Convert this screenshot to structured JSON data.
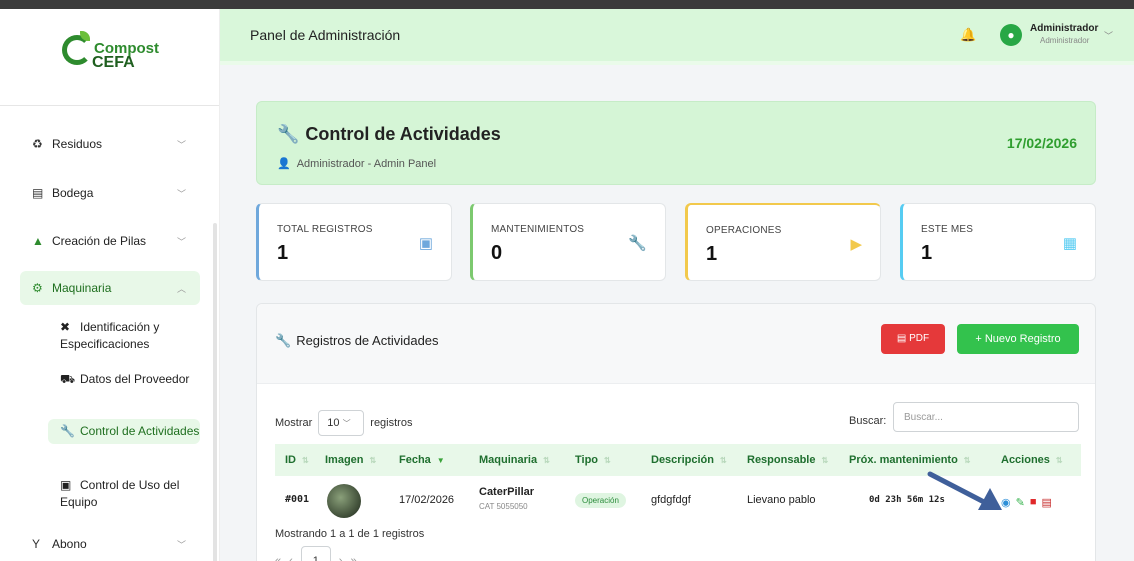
{
  "app": {
    "logo_line1": "Compost",
    "logo_line2": "CEFA",
    "accent": "#33c24d"
  },
  "sidebar": {
    "items": [
      {
        "label": "Residuos",
        "icon": "recycle-icon"
      },
      {
        "label": "Bodega",
        "icon": "warehouse-icon"
      },
      {
        "label": "Creación de Pilas",
        "icon": "mountain-icon"
      },
      {
        "label": "Maquinaria",
        "icon": "gears-icon"
      },
      {
        "label": "Abono",
        "icon": "seedling-icon"
      }
    ],
    "subitems": [
      {
        "label": "Identificación y Especificaciones",
        "icon": "tools-icon"
      },
      {
        "label": "Datos del Proveedor",
        "icon": "truck-icon"
      },
      {
        "label": "Control de Actividades",
        "icon": "wrench-icon"
      },
      {
        "label": "Control de Uso del Equipo",
        "icon": "clipboard-icon"
      }
    ]
  },
  "header": {
    "title": "Panel de Administración",
    "user_name": "Administrador",
    "user_role": "Administrador"
  },
  "hero": {
    "title": "Control de Actividades",
    "subtitle": "Administrador - Admin Panel",
    "date": "17/02/2026"
  },
  "stats": [
    {
      "label": "TOTAL REGISTROS",
      "value": "1",
      "color": "#6fa8dc"
    },
    {
      "label": "MANTENIMIENTOS",
      "value": "0",
      "color": "#7cc96f"
    },
    {
      "label": "OPERACIONES",
      "value": "1",
      "color": "#f2c94c"
    },
    {
      "label": "ESTE MES",
      "value": "1",
      "color": "#56ccf2"
    }
  ],
  "panel": {
    "title": "Registros de Actividades",
    "pdf_label": "PDF",
    "new_label": "+ Nuevo Registro",
    "show_label": "Mostrar",
    "page_size": "10",
    "records_label": "registros",
    "search_label": "Buscar:",
    "search_placeholder": "Buscar...",
    "columns": [
      "ID",
      "Imagen",
      "Fecha",
      "Maquinaria",
      "Tipo",
      "Descripción",
      "Responsable",
      "Próx. mantenimiento",
      "Acciones"
    ],
    "rows": [
      {
        "id": "#001",
        "fecha": "17/02/2026",
        "maquinaria": "CaterPillar",
        "maquinaria_sub": "CAT 5055050",
        "tipo": "Operación",
        "descripcion": "gfdgfdgf",
        "responsable": "Lievano pablo",
        "prox": "0d 23h 56m 12s"
      }
    ],
    "footer": "Mostrando 1 a 1 de 1 registros",
    "current_page": "1"
  }
}
